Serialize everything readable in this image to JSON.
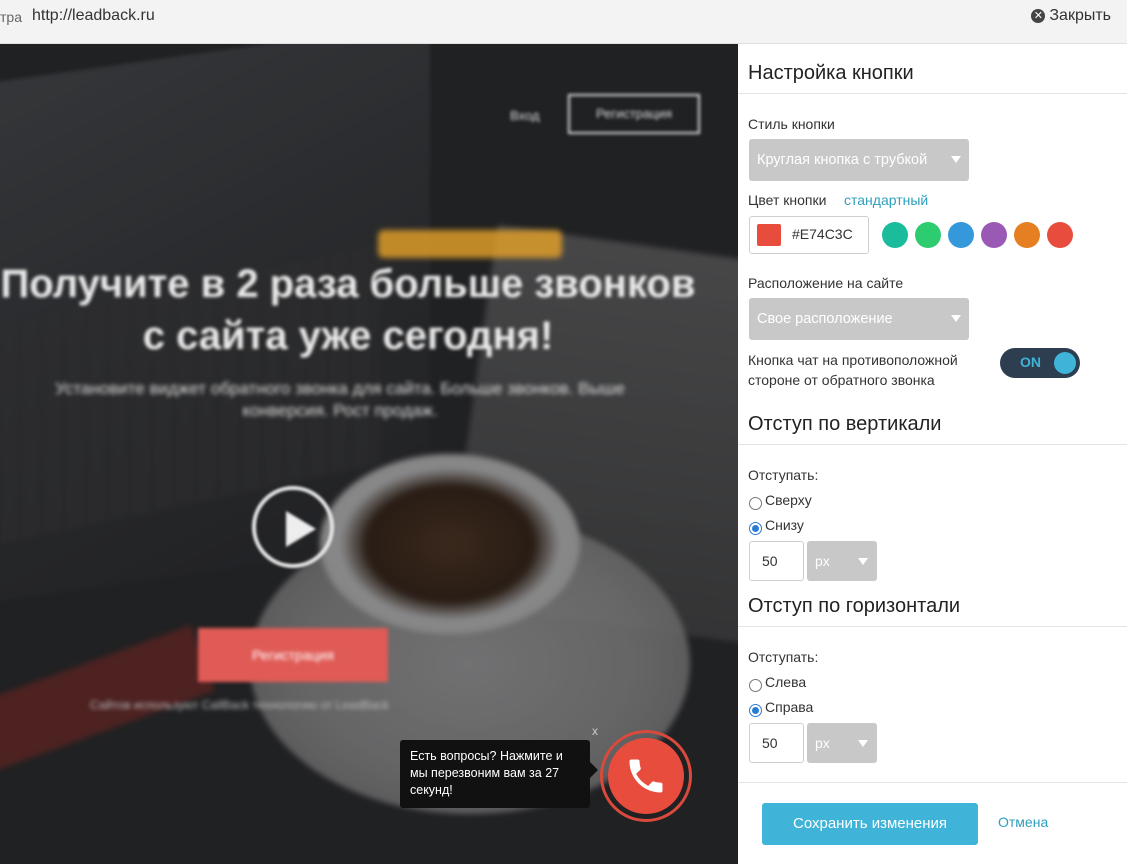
{
  "topbar": {
    "left_cut": "тра",
    "url": "http://leadback.ru",
    "close_label": "Закрыть"
  },
  "preview": {
    "nav_login": "Вход",
    "nav_register": "Регистрация",
    "hero_title": "Получите в 2 раза больше звонков с сайта уже сегодня!",
    "hero_subtitle": "Установите виджет обратного звонка для сайта. Больше звонков. Выше конверсия. Рост продаж.",
    "cta_label": "Регистрация",
    "foot_note": "Сайтов используют CallBack технологию от LeadBack",
    "bubble_text": "Есть вопросы? Нажмите и мы перезвоним вам за 27 секунд!",
    "bubble_close": "x",
    "call_button_color": "#E74C3C"
  },
  "panel": {
    "title": "Настройка кнопки",
    "style_label": "Стиль кнопки",
    "style_value": "Круглая кнопка с трубкой",
    "color_label": "Цвет кнопки",
    "color_default_link": "стандартный",
    "color_value": "#E74C3C",
    "palette": [
      "#1abc9c",
      "#2ecc71",
      "#3498db",
      "#9b59b6",
      "#e67e22",
      "#e74c3c"
    ],
    "position_label": "Расположение на сайте",
    "position_value": "Свое расположение",
    "chat_toggle_label": "Кнопка чат на противоположной стороне от обратного звонка",
    "chat_toggle_state": "ON",
    "vertical": {
      "title": "Отступ по вертикали",
      "offset_label": "Отступать:",
      "option_top": "Сверху",
      "option_bottom": "Снизу",
      "selected": "Снизу",
      "value": "50",
      "unit": "px"
    },
    "horizontal": {
      "title": "Отступ по горизонтали",
      "offset_label": "Отступать:",
      "option_left": "Слева",
      "option_right": "Справа",
      "selected": "Справа",
      "value": "50",
      "unit": "px"
    },
    "save_label": "Сохранить изменения",
    "cancel_label": "Отмена"
  }
}
